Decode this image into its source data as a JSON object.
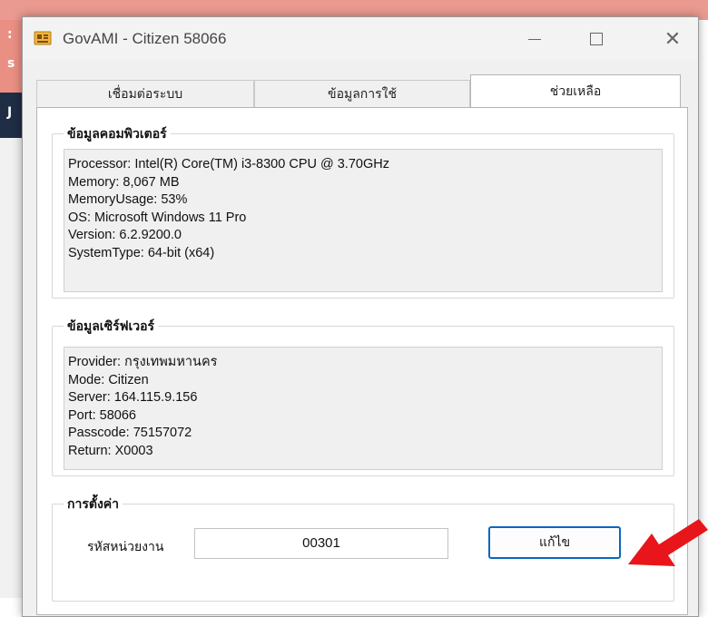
{
  "window": {
    "title": "GovAMI - Citizen 58066",
    "controls": {
      "minimize": "minimize",
      "maximize": "maximize",
      "close": "✕"
    }
  },
  "tabs": [
    {
      "label": "เชื่อมต่อระบบ",
      "active": false
    },
    {
      "label": "ข้อมูลการใช้",
      "active": false
    },
    {
      "label": "ช่วยเหลือ",
      "active": true
    }
  ],
  "computer_info": {
    "heading": "ข้อมูลคอมพิวเตอร์",
    "lines": [
      "Processor: Intel(R) Core(TM) i3-8300 CPU @ 3.70GHz",
      "Memory: 8,067 MB",
      "MemoryUsage: 53%",
      "OS: Microsoft Windows 11 Pro",
      "Version: 6.2.9200.0",
      "SystemType: 64-bit (x64)"
    ]
  },
  "server_info": {
    "heading": "ข้อมูลเซิร์ฟเวอร์",
    "lines": [
      "Provider: กรุงเทพมหานคร",
      "Mode: Citizen",
      "Server: 164.115.9.156",
      "Port: 58066",
      "Passcode: 75157072",
      "Return: X0003"
    ]
  },
  "settings": {
    "heading": "การตั้งค่า",
    "agency_label": "รหัสหน่วยงาน",
    "agency_value": "00301",
    "edit_label": "แก้ไข"
  },
  "colors": {
    "accent": "#0a66c2",
    "arrow": "#e8151b",
    "background_app": "#ea9a90"
  }
}
